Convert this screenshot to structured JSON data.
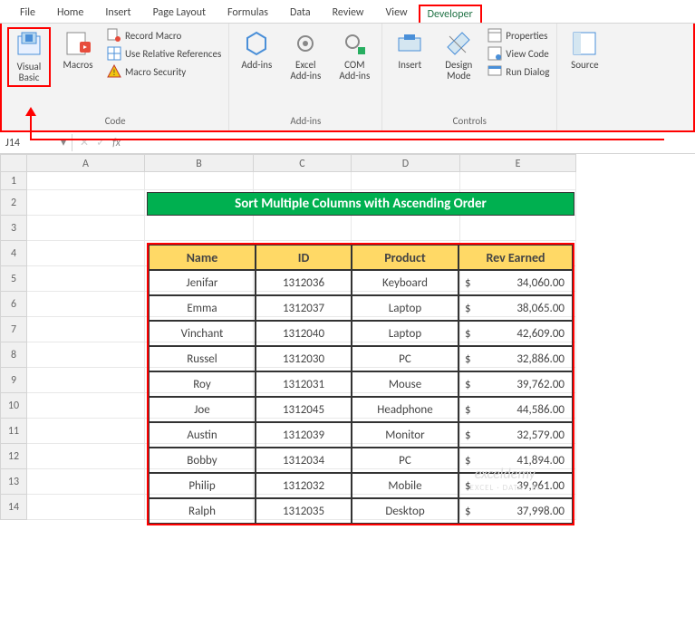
{
  "tabs": {
    "file": "File",
    "home": "Home",
    "insert": "Insert",
    "pagelayout": "Page Layout",
    "formulas": "Formulas",
    "data": "Data",
    "review": "Review",
    "view": "View",
    "developer": "Developer"
  },
  "ribbon": {
    "code": {
      "vb": "Visual Basic",
      "macros": "Macros",
      "record": "Record Macro",
      "relref": "Use Relative References",
      "security": "Macro Security",
      "label": "Code"
    },
    "addins": {
      "addins": "Add-ins",
      "excel": "Excel Add-ins",
      "com": "COM Add-ins",
      "label": "Add-ins"
    },
    "controls": {
      "insert": "Insert",
      "design": "Design Mode",
      "props": "Properties",
      "viewcode": "View Code",
      "rundlg": "Run Dialog",
      "label": "Controls"
    },
    "source": {
      "label": "Source"
    }
  },
  "namebox": "J14",
  "formulabar": {
    "fx": "fx"
  },
  "cols": [
    "A",
    "B",
    "C",
    "D",
    "E"
  ],
  "rows": [
    "1",
    "2",
    "3",
    "4",
    "5",
    "6",
    "7",
    "8",
    "9",
    "10",
    "11",
    "12",
    "13",
    "14"
  ],
  "banner": "Sort Multiple Columns with Ascending Order",
  "headers": {
    "name": "Name",
    "id": "ID",
    "product": "Product",
    "rev": "Rev Earned"
  },
  "data": [
    {
      "name": "Jenifar",
      "id": "1312036",
      "product": "Keyboard",
      "cur": "$",
      "val": "34,060.00"
    },
    {
      "name": "Emma",
      "id": "1312037",
      "product": "Laptop",
      "cur": "$",
      "val": "38,065.00"
    },
    {
      "name": "Vinchant",
      "id": "1312040",
      "product": "Laptop",
      "cur": "$",
      "val": "42,609.00"
    },
    {
      "name": "Russel",
      "id": "1312030",
      "product": "PC",
      "cur": "$",
      "val": "32,886.00"
    },
    {
      "name": "Roy",
      "id": "1312031",
      "product": "Mouse",
      "cur": "$",
      "val": "39,762.00"
    },
    {
      "name": "Joe",
      "id": "1312045",
      "product": "Headphone",
      "cur": "$",
      "val": "44,586.00"
    },
    {
      "name": "Austin",
      "id": "1312039",
      "product": "Monitor",
      "cur": "$",
      "val": "32,579.00"
    },
    {
      "name": "Bobby",
      "id": "1312034",
      "product": "PC",
      "cur": "$",
      "val": "41,894.00"
    },
    {
      "name": "Philip",
      "id": "1312032",
      "product": "Mobile",
      "cur": "$",
      "val": "39,961.00"
    },
    {
      "name": "Ralph",
      "id": "1312035",
      "product": "Desktop",
      "cur": "$",
      "val": "37,998.00"
    }
  ],
  "watermark": {
    "l1": "exceldemy",
    "l2": "EXCEL · DATA · BI"
  }
}
